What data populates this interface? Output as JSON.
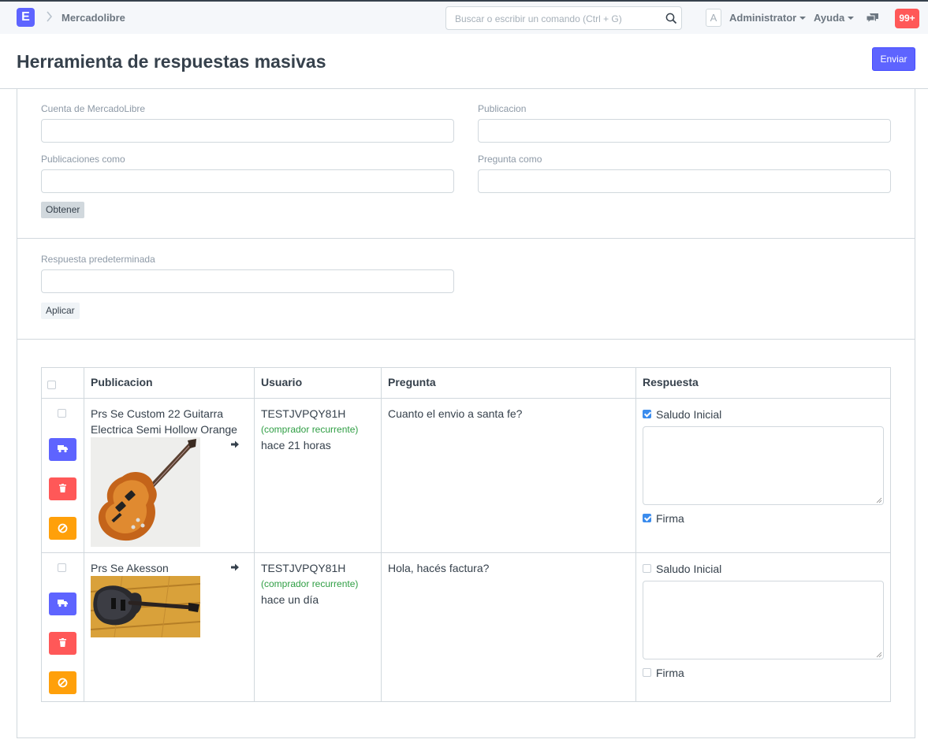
{
  "navbar": {
    "brand_letter": "E",
    "breadcrumb": "Mercadolibre",
    "search_placeholder": "Buscar o escribir un comando (Ctrl + G)",
    "avatar_letter": "A",
    "user_menu": "Administrator",
    "help_menu": "Ayuda",
    "notifications_count": "99+"
  },
  "page": {
    "title": "Herramienta de respuestas masivas",
    "primary_action": "Enviar"
  },
  "form": {
    "cuenta_label": "Cuenta de MercadoLibre",
    "cuenta_value": "",
    "publicacion_label": "Publicacion",
    "publicacion_value": "",
    "publicaciones_como_label": "Publicaciones como",
    "publicaciones_como_value": "",
    "pregunta_como_label": "Pregunta como",
    "pregunta_como_value": "",
    "obtener_label": "Obtener",
    "respuesta_label": "Respuesta predeterminada",
    "respuesta_value": "",
    "aplicar_label": "Aplicar"
  },
  "table": {
    "headers": [
      "Publicacion",
      "Usuario",
      "Pregunta",
      "Respuesta"
    ],
    "rows": [
      {
        "selected": false,
        "publicacion": "Prs Se Custom 22 Guitarra Electrica Semi Hollow Orange",
        "image": "orange-semi-hollow-guitar",
        "usuario": "TESTJVPQY81H",
        "usuario_tag": "(comprador recurrente)",
        "tiempo": "hace 21 horas",
        "pregunta": "Cuanto el envio a santa fe?",
        "saludo_label": "Saludo Inicial",
        "saludo_checked": true,
        "respuesta": "",
        "firma_label": "Firma",
        "firma_checked": true
      },
      {
        "selected": false,
        "publicacion": "Prs Se Akesson",
        "image": "dark-guitar-on-wood",
        "usuario": "TESTJVPQY81H",
        "usuario_tag": "(comprador recurrente)",
        "tiempo": "hace un día",
        "pregunta": "Hola, hacés factura?",
        "saludo_label": "Saludo Inicial",
        "saludo_checked": false,
        "respuesta": "",
        "firma_label": "Firma",
        "firma_checked": false
      }
    ]
  },
  "icons": {
    "brand": "app-logo",
    "search": "search-icon",
    "chat": "chat-icon",
    "truck": "truck-icon",
    "trash": "trash-icon",
    "ban": "ban-icon",
    "arrow": "arrow-right-icon"
  },
  "colors": {
    "primary": "#5e64ff",
    "danger": "#ff5858",
    "warning": "#ffa00a",
    "success_text": "#2f9e44",
    "checkbox": "#3b8ced"
  }
}
